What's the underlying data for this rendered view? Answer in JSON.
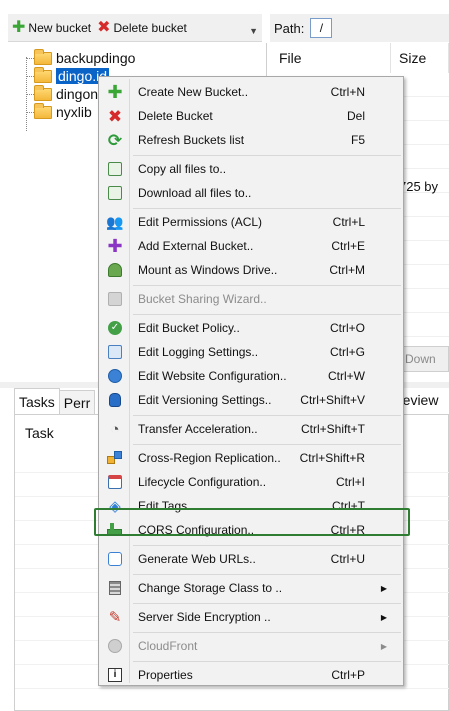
{
  "toolbar": {
    "new_bucket_label": "New bucket",
    "delete_bucket_label": "Delete bucket"
  },
  "path": {
    "label": "Path:",
    "value": "/"
  },
  "tree": {
    "items": [
      {
        "label": "backupdingo",
        "selected": false
      },
      {
        "label": "dingo.id",
        "selected": true
      },
      {
        "label": "dingon",
        "selected": false
      },
      {
        "label": "nyxlib",
        "selected": false
      }
    ]
  },
  "files": {
    "columns": [
      "File",
      "Size"
    ],
    "size_value": "725 by",
    "download_label": "Down"
  },
  "tabs": {
    "items": [
      "Tasks",
      "Perr"
    ],
    "right_fragment": "review"
  },
  "tasks": {
    "header": "Task"
  },
  "menu": {
    "items": [
      {
        "label": "Create New Bucket..",
        "shortcut": "Ctrl+N",
        "icon": "plus-icon",
        "disabled": false
      },
      {
        "label": "Delete Bucket",
        "shortcut": "Del",
        "icon": "delete-x-icon",
        "disabled": false
      },
      {
        "label": "Refresh Buckets list",
        "shortcut": "F5",
        "icon": "refresh-icon",
        "disabled": false
      },
      {
        "label": "Copy all files to..",
        "shortcut": "",
        "icon": "copy-icon",
        "disabled": false
      },
      {
        "label": "Download all files to..",
        "shortcut": "",
        "icon": "download-icon",
        "disabled": false
      },
      {
        "label": "Edit Permissions (ACL)",
        "shortcut": "Ctrl+L",
        "icon": "users-icon",
        "disabled": false
      },
      {
        "label": "Add External Bucket..",
        "shortcut": "Ctrl+E",
        "icon": "purple-plus-icon",
        "disabled": false
      },
      {
        "label": "Mount as Windows Drive..",
        "shortcut": "Ctrl+M",
        "icon": "drive-icon",
        "disabled": false
      },
      {
        "label": "Bucket Sharing Wizard..",
        "shortcut": "",
        "icon": "share-icon",
        "disabled": true
      },
      {
        "label": "Edit Bucket Policy..",
        "shortcut": "Ctrl+O",
        "icon": "policy-check-icon",
        "disabled": false
      },
      {
        "label": "Edit Logging Settings..",
        "shortcut": "Ctrl+G",
        "icon": "logging-icon",
        "disabled": false
      },
      {
        "label": "Edit Website Configuration..",
        "shortcut": "Ctrl+W",
        "icon": "globe-icon",
        "disabled": false
      },
      {
        "label": "Edit Versioning Settings..",
        "shortcut": "Ctrl+Shift+V",
        "icon": "versioning-icon",
        "disabled": false
      },
      {
        "label": "Transfer Acceleration..",
        "shortcut": "Ctrl+Shift+T",
        "icon": "acceleration-icon",
        "disabled": false
      },
      {
        "label": "Cross-Region Replication..",
        "shortcut": "Ctrl+Shift+R",
        "icon": "replication-icon",
        "disabled": false
      },
      {
        "label": "Lifecycle Configuration..",
        "shortcut": "Ctrl+I",
        "icon": "calendar-icon",
        "disabled": false
      },
      {
        "label": "Edit Tags..",
        "shortcut": "Ctrl+T",
        "icon": "tag-icon",
        "disabled": false
      },
      {
        "label": "CORS Configuration..",
        "shortcut": "Ctrl+R",
        "icon": "cors-icon",
        "disabled": false
      },
      {
        "label": "Generate Web URLs..",
        "shortcut": "Ctrl+U",
        "icon": "web-url-icon",
        "disabled": false
      },
      {
        "label": "Change Storage Class to ..",
        "shortcut": "",
        "icon": "storage-icon",
        "disabled": false,
        "submenu": true
      },
      {
        "label": "Server Side Encryption ..",
        "shortcut": "",
        "icon": "encryption-icon",
        "disabled": false,
        "submenu": true
      },
      {
        "label": "CloudFront",
        "shortcut": "",
        "icon": "cloudfront-icon",
        "disabled": true,
        "submenu": true
      },
      {
        "label": "Properties",
        "shortcut": "Ctrl+P",
        "icon": "info-icon",
        "disabled": false
      }
    ]
  },
  "colors": {
    "selection": "#0a64c8",
    "highlight_border": "#2f7d32",
    "menu_bg": "#f2f2f2"
  }
}
